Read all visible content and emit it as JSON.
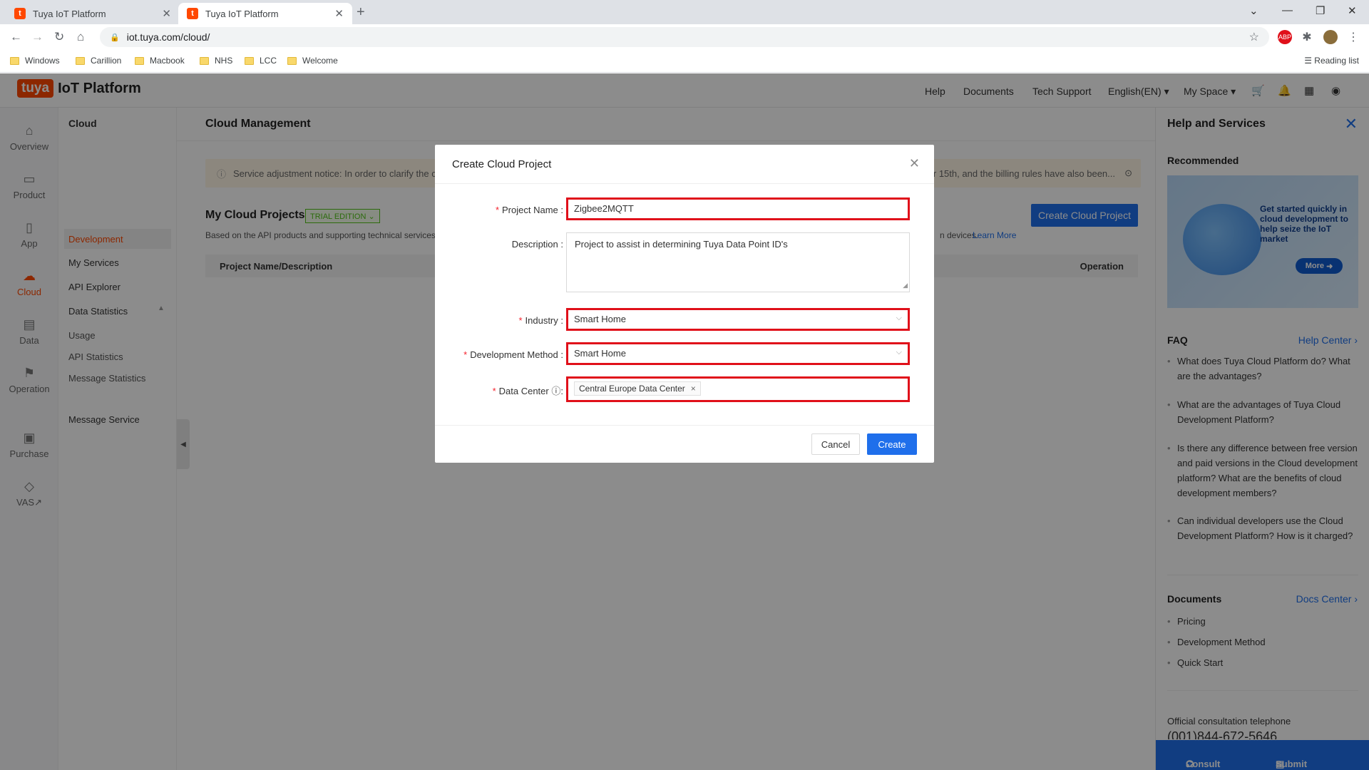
{
  "browser": {
    "tabs": [
      {
        "title": "Tuya IoT Platform",
        "active": false
      },
      {
        "title": "Tuya IoT Platform",
        "active": true
      }
    ],
    "url": "iot.tuya.com/cloud/",
    "bookmarks": [
      "Windows",
      "Carillion",
      "Macbook",
      "NHS",
      "LCC",
      "Welcome"
    ],
    "reading_list": "Reading list"
  },
  "header": {
    "logo_mark": "tuya",
    "logo_text": "IoT Platform",
    "nav": [
      "Help",
      "Documents",
      "Tech Support",
      "English(EN)",
      "My Space"
    ]
  },
  "left_rail": [
    {
      "label": "Overview",
      "icon": "home-icon"
    },
    {
      "label": "Product",
      "icon": "product-icon"
    },
    {
      "label": "App",
      "icon": "app-icon"
    },
    {
      "label": "Cloud",
      "icon": "cloud-icon",
      "active": true
    },
    {
      "label": "Data",
      "icon": "data-icon"
    },
    {
      "label": "Operation",
      "icon": "operation-icon"
    },
    {
      "label": "Purchase",
      "icon": "purchase-icon"
    },
    {
      "label": "VAS",
      "icon": "vas-icon"
    }
  ],
  "subnav": {
    "title": "Cloud",
    "items": [
      "Development",
      "My Services",
      "API Explorer",
      "Data Statistics",
      "Usage",
      "API Statistics",
      "Message Statistics",
      "Message Service"
    ]
  },
  "main": {
    "title": "Cloud Management",
    "notice": "Service adjustment notice: In order to clarify the c",
    "notice_tail": "er 15th, and the billing rules have also been...",
    "projects_title": "My Cloud Projects",
    "trial_badge": "TRIAL EDITION",
    "based_text": "Based on the API products and supporting technical services",
    "based_tail": "n devices.",
    "learn_more": "Learn More",
    "create_button": "Create Cloud Project",
    "table_headers": [
      "Project Name/Description",
      "Operation"
    ]
  },
  "help_panel": {
    "title": "Help and Services",
    "recommended": "Recommended",
    "banner_text": "Get started quickly in cloud development to help seize the IoT market",
    "banner_more": "More",
    "faq_title": "FAQ",
    "faq_link": "Help Center",
    "faq": [
      "What does Tuya Cloud Platform do? What are the advantages?",
      "What are the advantages of Tuya Cloud Development Platform?",
      "Is there any difference between free version and paid versions in the Cloud development platform? What are the benefits of cloud development members?",
      "Can individual developers use the Cloud Development Platform? How is it charged?"
    ],
    "docs_title": "Documents",
    "docs_link": "Docs Center",
    "docs": [
      "Pricing",
      "Development Method",
      "Quick Start"
    ],
    "phone_label": "Official consultation telephone",
    "phone": "(001)844-672-5646",
    "consult": "Consult",
    "submit_question": "Submit Question"
  },
  "modal": {
    "title": "Create Cloud Project",
    "project_name_label": "Project Name",
    "project_name_value": "Zigbee2MQTT",
    "description_label": "Description",
    "description_value": "Project to assist in determining Tuya Data Point ID's",
    "industry_label": "Industry",
    "industry_value": "Smart Home",
    "dev_method_label": "Development Method",
    "dev_method_value": "Smart Home",
    "data_center_label": "Data Center",
    "data_center_value": "Central Europe Data Center",
    "cancel": "Cancel",
    "create": "Create"
  },
  "colors": {
    "brand": "#ff4800",
    "primary": "#1f6feb",
    "highlight": "#e0101a"
  }
}
